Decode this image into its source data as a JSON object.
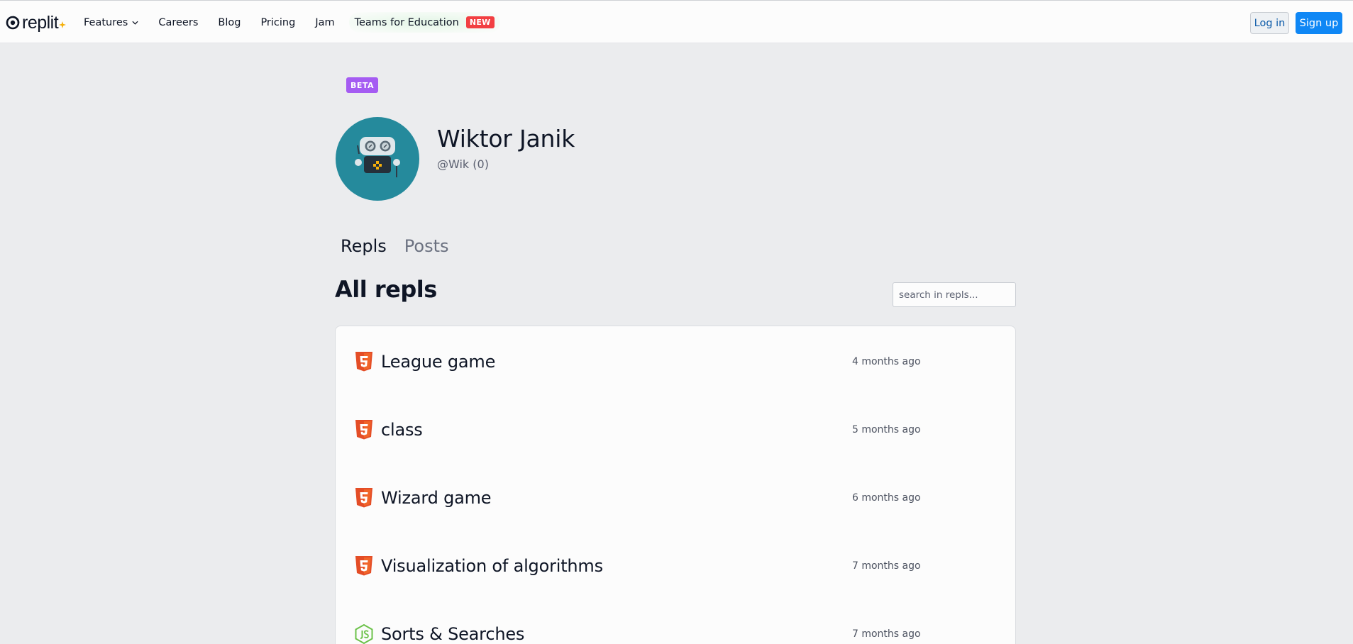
{
  "header": {
    "logo_text": "replit",
    "nav": [
      {
        "label": "Features"
      },
      {
        "label": "Careers"
      },
      {
        "label": "Blog"
      },
      {
        "label": "Pricing"
      },
      {
        "label": "Jam"
      }
    ],
    "teams_label": "Teams for Education",
    "new_badge": "NEW",
    "login_label": "Log in",
    "signup_label": "Sign up"
  },
  "profile": {
    "beta_badge": "BETA",
    "name": "Wiktor Janik",
    "handle": "@Wik (0)"
  },
  "tabs": [
    {
      "label": "Repls",
      "active": true
    },
    {
      "label": "Posts",
      "active": false
    }
  ],
  "repls": {
    "title": "All repls",
    "search_placeholder": "search in repls...",
    "items": [
      {
        "name": "League game",
        "time": "4 months ago",
        "icon": "html5-icon"
      },
      {
        "name": "class",
        "time": "5 months ago",
        "icon": "html5-icon"
      },
      {
        "name": "Wizard game",
        "time": "6 months ago",
        "icon": "html5-icon"
      },
      {
        "name": "Visualization of algorithms",
        "time": "7 months ago",
        "icon": "html5-icon"
      },
      {
        "name": "Sorts & Searches",
        "time": "7 months ago",
        "icon": "nodejs-icon"
      }
    ]
  },
  "colors": {
    "accent": "#0f87f5",
    "beta": "#a55cf2",
    "new": "#f23f42",
    "html5": "#e44d26",
    "nodejs": "#6cc24a",
    "avatar_bg": "#258a9c"
  }
}
